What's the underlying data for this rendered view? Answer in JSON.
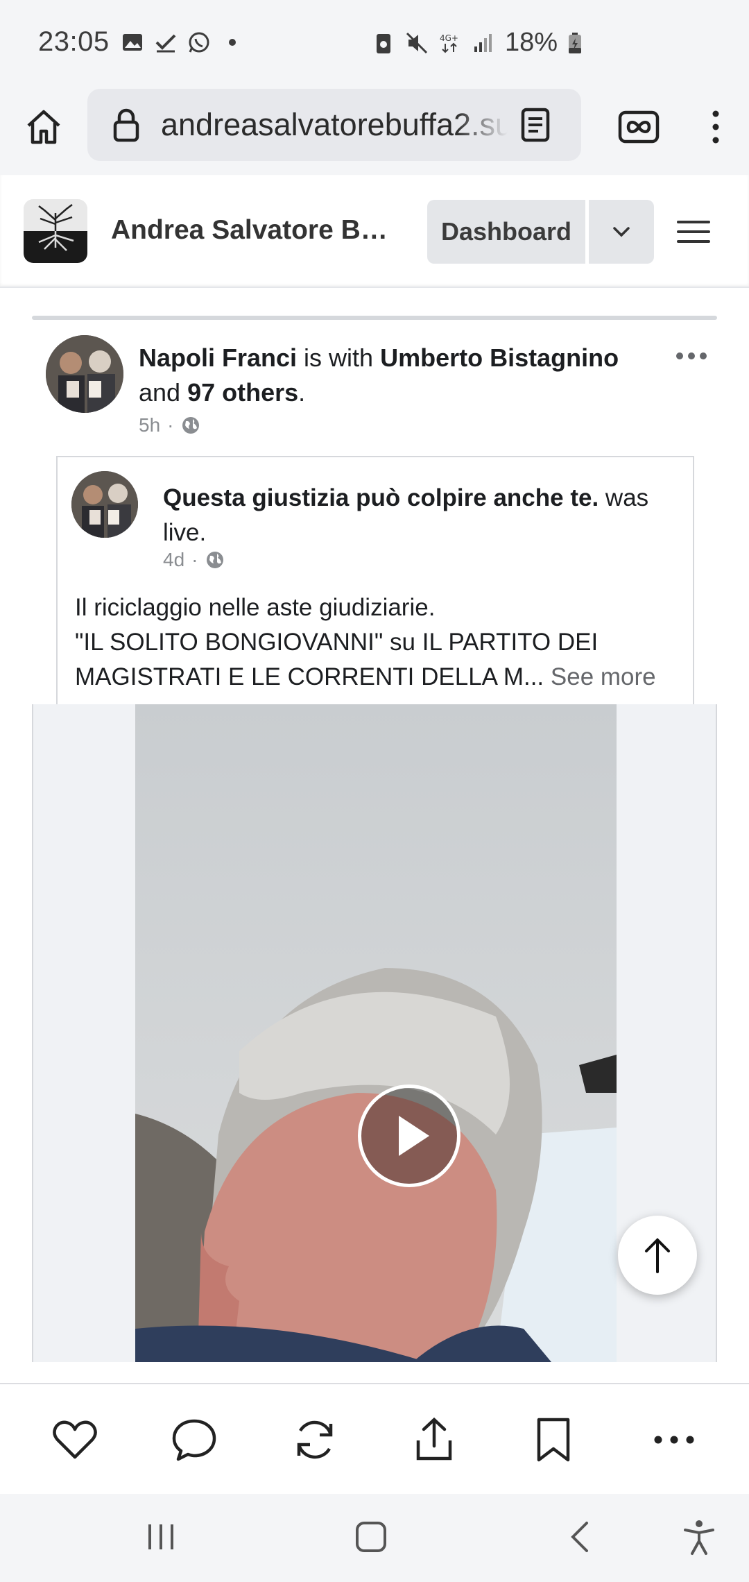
{
  "status_bar": {
    "time": "23:05",
    "battery": "18%",
    "icons": [
      "gallery-icon",
      "check-icon",
      "whatsapp-icon",
      "dot-icon",
      "battery-saver-icon",
      "mute-icon",
      "4g-icon",
      "signal-icon",
      "battery-icon"
    ]
  },
  "browser": {
    "url": "andreasalvatorebuffa2.su",
    "tab_count_icon": "infinity-tabs-icon"
  },
  "site_header": {
    "title": "Andrea Salvatore Buff...",
    "dashboard_label": "Dashboard"
  },
  "post": {
    "author": "Napoli Franci",
    "with_text": " is with ",
    "tagged": "Umberto Bistagnino",
    "and_text": "and ",
    "others": "97 others",
    "period": ".",
    "time": "5h",
    "shared": {
      "author": "Questa giustizia può colpire anche te.",
      "action": " was live.",
      "time": "4d",
      "text_line1": "Il riciclaggio nelle aste giudiziarie.",
      "text_line2": "\"IL SOLITO BONGIOVANNI\" su IL PARTITO DEI",
      "text_line3": "MAGISTRATI E LE CORRENTI DELLA M...",
      "see_more": "See more"
    }
  },
  "colors": {
    "accent": "#1c1e21",
    "meta": "#8a8d91",
    "chrome_bg": "#f4f5f7"
  }
}
